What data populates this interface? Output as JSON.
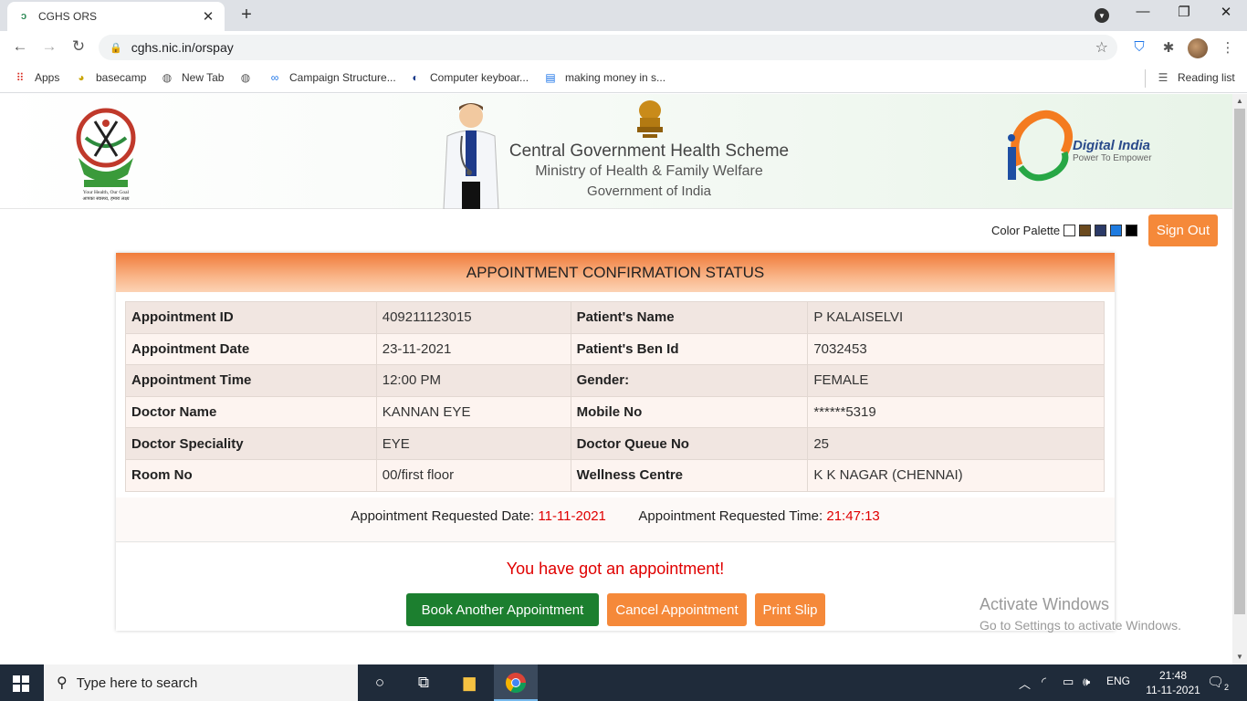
{
  "browser": {
    "tab_title": "CGHS ORS",
    "tab_close": "✕",
    "new_tab": "+",
    "url": "cghs.nic.in/orspay",
    "bookmarks": [
      {
        "label": "Apps",
        "icon": "apps-grid-icon"
      },
      {
        "label": "basecamp",
        "icon": "basecamp-icon"
      },
      {
        "label": "New Tab",
        "icon": "globe-icon"
      },
      {
        "label": "",
        "icon": "globe-icon"
      },
      {
        "label": "Campaign Structure...",
        "icon": "link-icon"
      },
      {
        "label": "Computer keyboar...",
        "icon": "page-icon"
      },
      {
        "label": "making money in s...",
        "icon": "doc-icon"
      }
    ],
    "reading_list": "Reading list"
  },
  "banner": {
    "line1": "Central Government Health Scheme",
    "line2": "Ministry of Health & Family Welfare",
    "line3": "Government of India",
    "cghs_tagline1": "Your Health, Our Goal",
    "cghs_tagline2": "आपका स्वास्थ्य, हमारा लक्ष्य",
    "digital_india": "Digital India",
    "digital_india_sub": "Power To Empower"
  },
  "palette": {
    "label": "Color Palette",
    "swatches": [
      "#ffffff",
      "#6b4a1e",
      "#2b3a67",
      "#1e7be0",
      "#000000"
    ]
  },
  "signout_label": "Sign Out",
  "card": {
    "title": "APPOINTMENT CONFIRMATION STATUS",
    "rows": [
      {
        "l1": "Appointment ID",
        "v1": "409211123015",
        "l2": "Patient's Name",
        "v2": "P KALAISELVI"
      },
      {
        "l1": "Appointment Date",
        "v1": "23-11-2021",
        "l2": "Patient's Ben Id",
        "v2": "7032453"
      },
      {
        "l1": "Appointment Time",
        "v1": "12:00 PM",
        "l2": "Gender:",
        "v2": "FEMALE"
      },
      {
        "l1": "Doctor Name",
        "v1": "KANNAN EYE",
        "l2": "Mobile No",
        "v2": "******5319"
      },
      {
        "l1": "Doctor Speciality",
        "v1": "EYE",
        "l2": "Doctor Queue No",
        "v2": "25"
      },
      {
        "l1": "Room No",
        "v1": "00/first floor",
        "l2": "Wellness Centre",
        "v2": "K K NAGAR (CHENNAI)"
      }
    ],
    "req_date_label": "Appointment Requested Date:",
    "req_date": "11-11-2021",
    "req_time_label": "Appointment Requested Time:",
    "req_time": "21:47:13",
    "message": "You have got an appointment!",
    "btn_book": "Book Another Appointment",
    "btn_cancel": "Cancel Appointment",
    "btn_print": "Print Slip"
  },
  "watermark": {
    "line1": "Activate Windows",
    "line2": "Go to Settings to activate Windows."
  },
  "taskbar": {
    "search_placeholder": "Type here to search",
    "lang": "ENG",
    "time": "21:48",
    "date": "11-11-2021",
    "notifications": "2"
  },
  "colors": {
    "accent_orange": "#f5893a",
    "accent_green": "#1c7f2f",
    "alert_red": "#e00000"
  }
}
